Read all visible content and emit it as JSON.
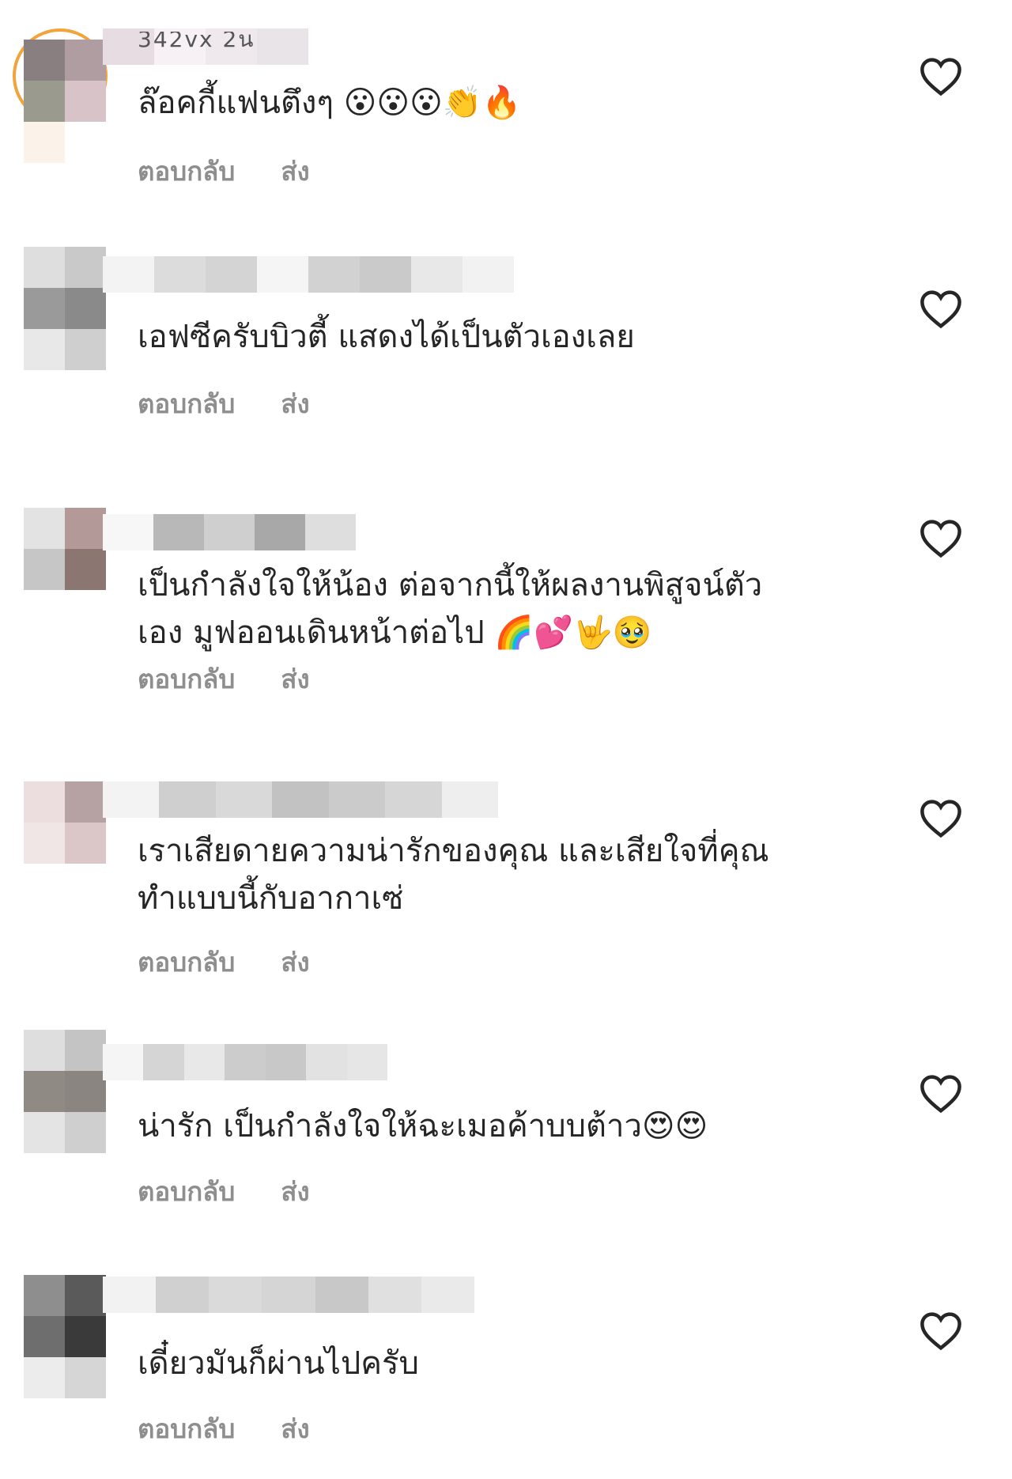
{
  "comments": [
    {
      "meta": "342vx 2น",
      "text": "ล๊อคกี้แฟนตึงๆ 😮😮😮👏🔥",
      "reply_label": "ตอบกลับ",
      "send_label": "ส่ง"
    },
    {
      "text": "เอฟซีครับบิวตี้ แสดงได้เป็นตัวเองเลย",
      "reply_label": "ตอบกลับ",
      "send_label": "ส่ง"
    },
    {
      "text": "เป็นกำลังใจให้น้อง ต่อจากนี้ให้ผลงานพิสูจน์ตัว\nเอง มูฟออนเดินหน้าต่อไป 🌈💕🤟🥹",
      "reply_label": "ตอบกลับ",
      "send_label": "ส่ง"
    },
    {
      "text": "เราเสียดายความน่ารักของคุณ และเสียใจที่คุณ\nทำแบบนี้กับอากาเซ่",
      "reply_label": "ตอบกลับ",
      "send_label": "ส่ง"
    },
    {
      "text": "น่ารัก เป็นกำลังใจให้ฉะเมอค้าบบต้าว😍😍",
      "reply_label": "ตอบกลับ",
      "send_label": "ส่ง"
    },
    {
      "text": "เดี๋ยวมันก็ผ่านไปครับ",
      "reply_label": "ตอบกลับ",
      "send_label": "ส่ง"
    }
  ],
  "colors": {
    "text": "#262626",
    "secondary": "#8e8e8e",
    "heart": "#262626"
  },
  "icons": [
    "heart-icon"
  ]
}
